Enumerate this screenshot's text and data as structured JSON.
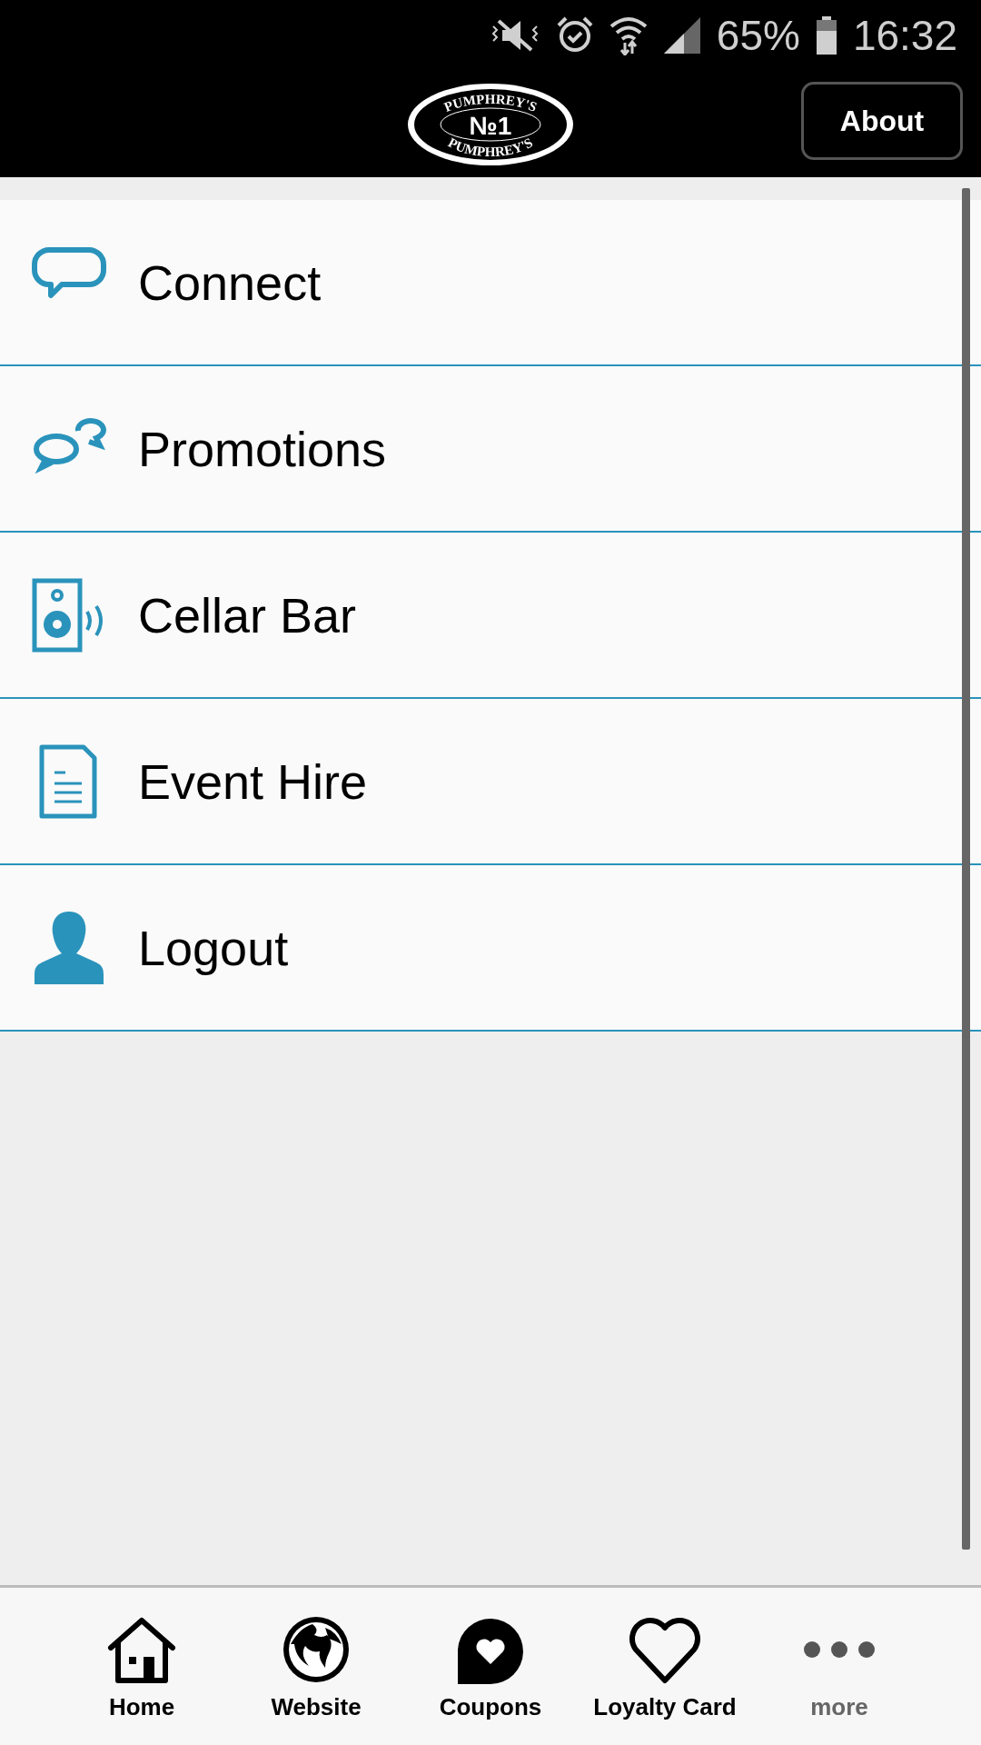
{
  "status_bar": {
    "battery": "65%",
    "time": "16:32"
  },
  "header": {
    "logo": {
      "top": "PUMPHREY'S",
      "mark": "№1",
      "bottom": "PUMPHREY'S"
    },
    "button": "About"
  },
  "menu": [
    {
      "kind": "chat",
      "label": "Connect"
    },
    {
      "kind": "chats",
      "label": "Promotions"
    },
    {
      "kind": "speaker",
      "label": "Cellar Bar"
    },
    {
      "kind": "document",
      "label": "Event Hire"
    },
    {
      "kind": "person",
      "label": "Logout"
    }
  ],
  "tab_bar": [
    {
      "kind": "home",
      "label": "Home"
    },
    {
      "kind": "globe",
      "label": "Website"
    },
    {
      "kind": "coupon",
      "label": "Coupons"
    },
    {
      "kind": "heart",
      "label": "Loyalty Card"
    },
    {
      "kind": "more",
      "label": "more"
    }
  ]
}
